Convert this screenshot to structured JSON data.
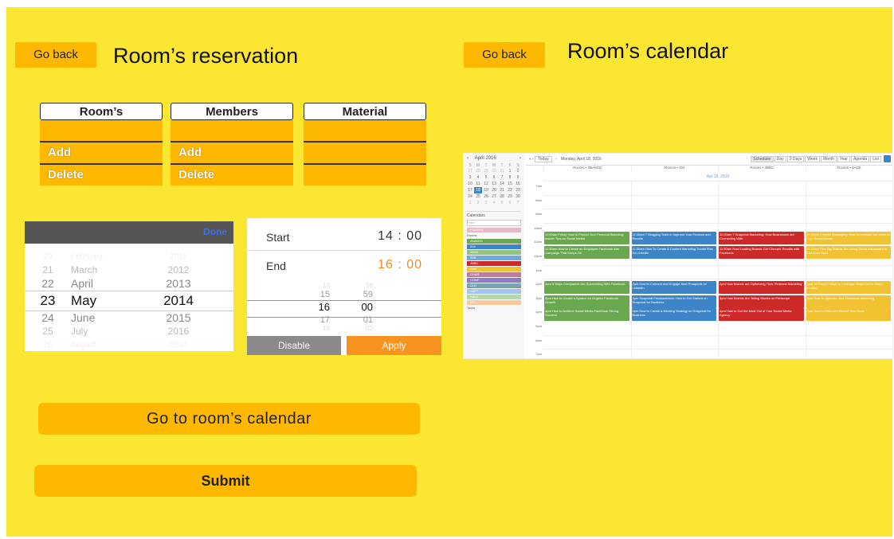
{
  "reservation": {
    "back_label": "Go back",
    "title": "Room’s reservation",
    "columns": [
      {
        "header": "Room’s",
        "cells": [
          "",
          "Add",
          "Delete"
        ]
      },
      {
        "header": "Members",
        "cells": [
          "",
          "Add",
          "Delete"
        ]
      },
      {
        "header": "Material",
        "cells": [
          "",
          "",
          ""
        ]
      }
    ]
  },
  "date_picker": {
    "done_label": "Done",
    "rows": [
      {
        "day": "20",
        "month": "February",
        "year": "2011"
      },
      {
        "day": "21",
        "month": "March",
        "year": "2012"
      },
      {
        "day": "22",
        "month": "April",
        "year": "2013"
      },
      {
        "day": "23",
        "month": "May",
        "year": "2014"
      },
      {
        "day": "24",
        "month": "June",
        "year": "2015"
      },
      {
        "day": "25",
        "month": "July",
        "year": "2016"
      },
      {
        "day": "26",
        "month": "August",
        "year": "2017"
      }
    ]
  },
  "time_picker": {
    "start_label": "Start",
    "start_value": "14 : 00",
    "end_label": "End",
    "end_value": "16 : 00",
    "end_color": "#f08a1c",
    "wheel": [
      {
        "h": "14",
        "m": "58"
      },
      {
        "h": "15",
        "m": "59"
      },
      {
        "h": "16",
        "m": "00"
      },
      {
        "h": "17",
        "m": "01"
      },
      {
        "h": "18",
        "m": "02"
      }
    ],
    "disable_label": "Disable",
    "apply_label": "Apply",
    "apply_color": "#f7931e"
  },
  "room_calendar": {
    "back_label": "Go back",
    "title": "Room’s calendar",
    "toolbar": {
      "month": "April 2016",
      "today": "Today",
      "date": "Monday, April 18, 2016",
      "views": [
        "Scheduler",
        "Day",
        "3 Days",
        "Week",
        "Month",
        "Year",
        "Agenda",
        "List"
      ]
    },
    "day_label": "Apr 18, 2016",
    "resources": [
      "Rooms • 2BAKED",
      "Rooms • 204",
      "Rooms • 3BBC",
      "Rooms • 3ADE"
    ],
    "times": [
      "7am",
      "8am",
      "9am",
      "10am",
      "11am",
      "12pm",
      "1pm",
      "2pm",
      "3pm",
      "4pm",
      "5pm",
      "6pm",
      "7pm"
    ],
    "calendars_label": "Calendars",
    "filter_placeholder": "Filter",
    "sidebar_items": [
      "Favorites",
      "Rooms",
      "2BAKED",
      "204",
      "3BSS",
      "3BB",
      "4BBC",
      "ADE",
      "CHAR",
      "CONF",
      "CLD",
      "LOFT",
      "SALE",
      "SPA",
      "Tasks"
    ],
    "mini_weekdays": [
      "S",
      "M",
      "T",
      "W",
      "T",
      "F",
      "S"
    ],
    "mini_days": [
      [
        "27",
        "28",
        "29",
        "30",
        "31",
        "1",
        "2"
      ],
      [
        "3",
        "4",
        "5",
        "6",
        "7",
        "8",
        "9"
      ],
      [
        "10",
        "11",
        "12",
        "13",
        "14",
        "15",
        "16"
      ],
      [
        "17",
        "18",
        "19",
        "20",
        "21",
        "22",
        "23"
      ],
      [
        "24",
        "25",
        "26",
        "27",
        "28",
        "29",
        "30"
      ],
      [
        "1",
        "2",
        "3",
        "4",
        "5",
        "6",
        "7"
      ]
    ],
    "events": [
      {
        "title": "11:00am Friday How to Protect Your Personal Branding: Insider Tips on Social Media",
        "color": "#6aa84f",
        "col": 0,
        "row": 0
      },
      {
        "title": "11:00am 7 Blogging Tools to Improve Your Process and Results",
        "color": "#3d85c6",
        "col": 1,
        "row": 0
      },
      {
        "title": "11:00am 7 Snapchat Marketing: How Businesses are Connecting With",
        "color": "#cc2929",
        "col": 2,
        "row": 0
      },
      {
        "title": "11:00am 7 Brand Messaging: How to Increase the Value of Your Social Media",
        "color": "#f1c232",
        "col": 3,
        "row": 0
      },
      {
        "title": "11:30am How to Create an Employee Facebook Ads Campaign That Keeps On",
        "color": "#6aa84f",
        "col": 0,
        "row": 1
      },
      {
        "title": "11:30am How To Create A Content Marketing Toolkit Plan for LinkedIn",
        "color": "#3d85c6",
        "col": 1,
        "row": 1
      },
      {
        "title": "11:30am How Leading Brands Get Cheaper Results with Facebook",
        "color": "#cc2929",
        "col": 2,
        "row": 1
      },
      {
        "title": "11:30am How Big Brands Are Using Social Influencers to Get More Buzz",
        "color": "#f1c232",
        "col": 3,
        "row": 1
      },
      {
        "title": "2pm 5 Ways Companies Are Succeeding With Facebook",
        "color": "#6aa84f",
        "col": 0,
        "row": 2
      },
      {
        "title": "2pm How to Connect and Engage New Prospects on LinkedIn",
        "color": "#3d85c6",
        "col": 1,
        "row": 2
      },
      {
        "title": "2pm How Brands are Optimizing Their Pinterest Marketing",
        "color": "#cc2929",
        "col": 2,
        "row": 2
      },
      {
        "title": "2pm 10 Proven Ways to Leverage Snapchat for Video Content",
        "color": "#f1c232",
        "col": 3,
        "row": 2
      },
      {
        "title": "3pm How to Create a System for Organic Facebook Growth",
        "color": "#6aa84f",
        "col": 0,
        "row": 3
      },
      {
        "title": "3pm Snapchat Fundamentals: How to Get Started on Snapchat for Business",
        "color": "#3d85c6",
        "col": 1,
        "row": 3
      },
      {
        "title": "3pm How Brands Are Telling Stories on Periscope",
        "color": "#cc2929",
        "col": 2,
        "row": 3
      },
      {
        "title": "3pm How to Optimize Your Facebook Marketing",
        "color": "#f1c232",
        "col": 3,
        "row": 3
      },
      {
        "title": "4pm How to Achieve Social Media Facebook Strong Success",
        "color": "#6aa84f",
        "col": 0,
        "row": 4
      },
      {
        "title": "4pm How to Create a Winning Strategy on Snapchat for Business",
        "color": "#3d85c6",
        "col": 1,
        "row": 4
      },
      {
        "title": "4pm How to Get the Most Out of Your Social Media Agency",
        "color": "#cc2929",
        "col": 2,
        "row": 4
      },
      {
        "title": "4pm How to Write and Market Your Book",
        "color": "#f1c232",
        "col": 3,
        "row": 4
      }
    ]
  },
  "actions": {
    "calendar_label": "Go to room’s calendar",
    "submit_label": "Submit"
  }
}
